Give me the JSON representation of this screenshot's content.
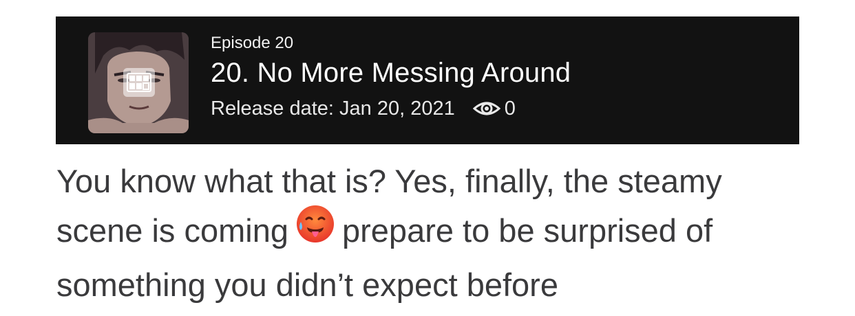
{
  "episode": {
    "number_label": "Episode 20",
    "title": "20. No More Messing Around",
    "release_text": "Release date: Jan 20, 2021",
    "view_count": "0",
    "icons": {
      "thumbnail_badge": "grid-icon",
      "views": "eye-icon"
    }
  },
  "post": {
    "line1": "You know what that is? Yes, finally, the steamy",
    "line2_before": "scene is coming",
    "line2_after": "prepare to be surprised of",
    "line3": "something you didn’t expect before",
    "emoji_icon": "hot-face-emoji-icon"
  },
  "colors": {
    "card_background": "#121212",
    "card_text": "#ffffff",
    "body_text": "#3a3a3c",
    "page_background": "#ffffff"
  }
}
